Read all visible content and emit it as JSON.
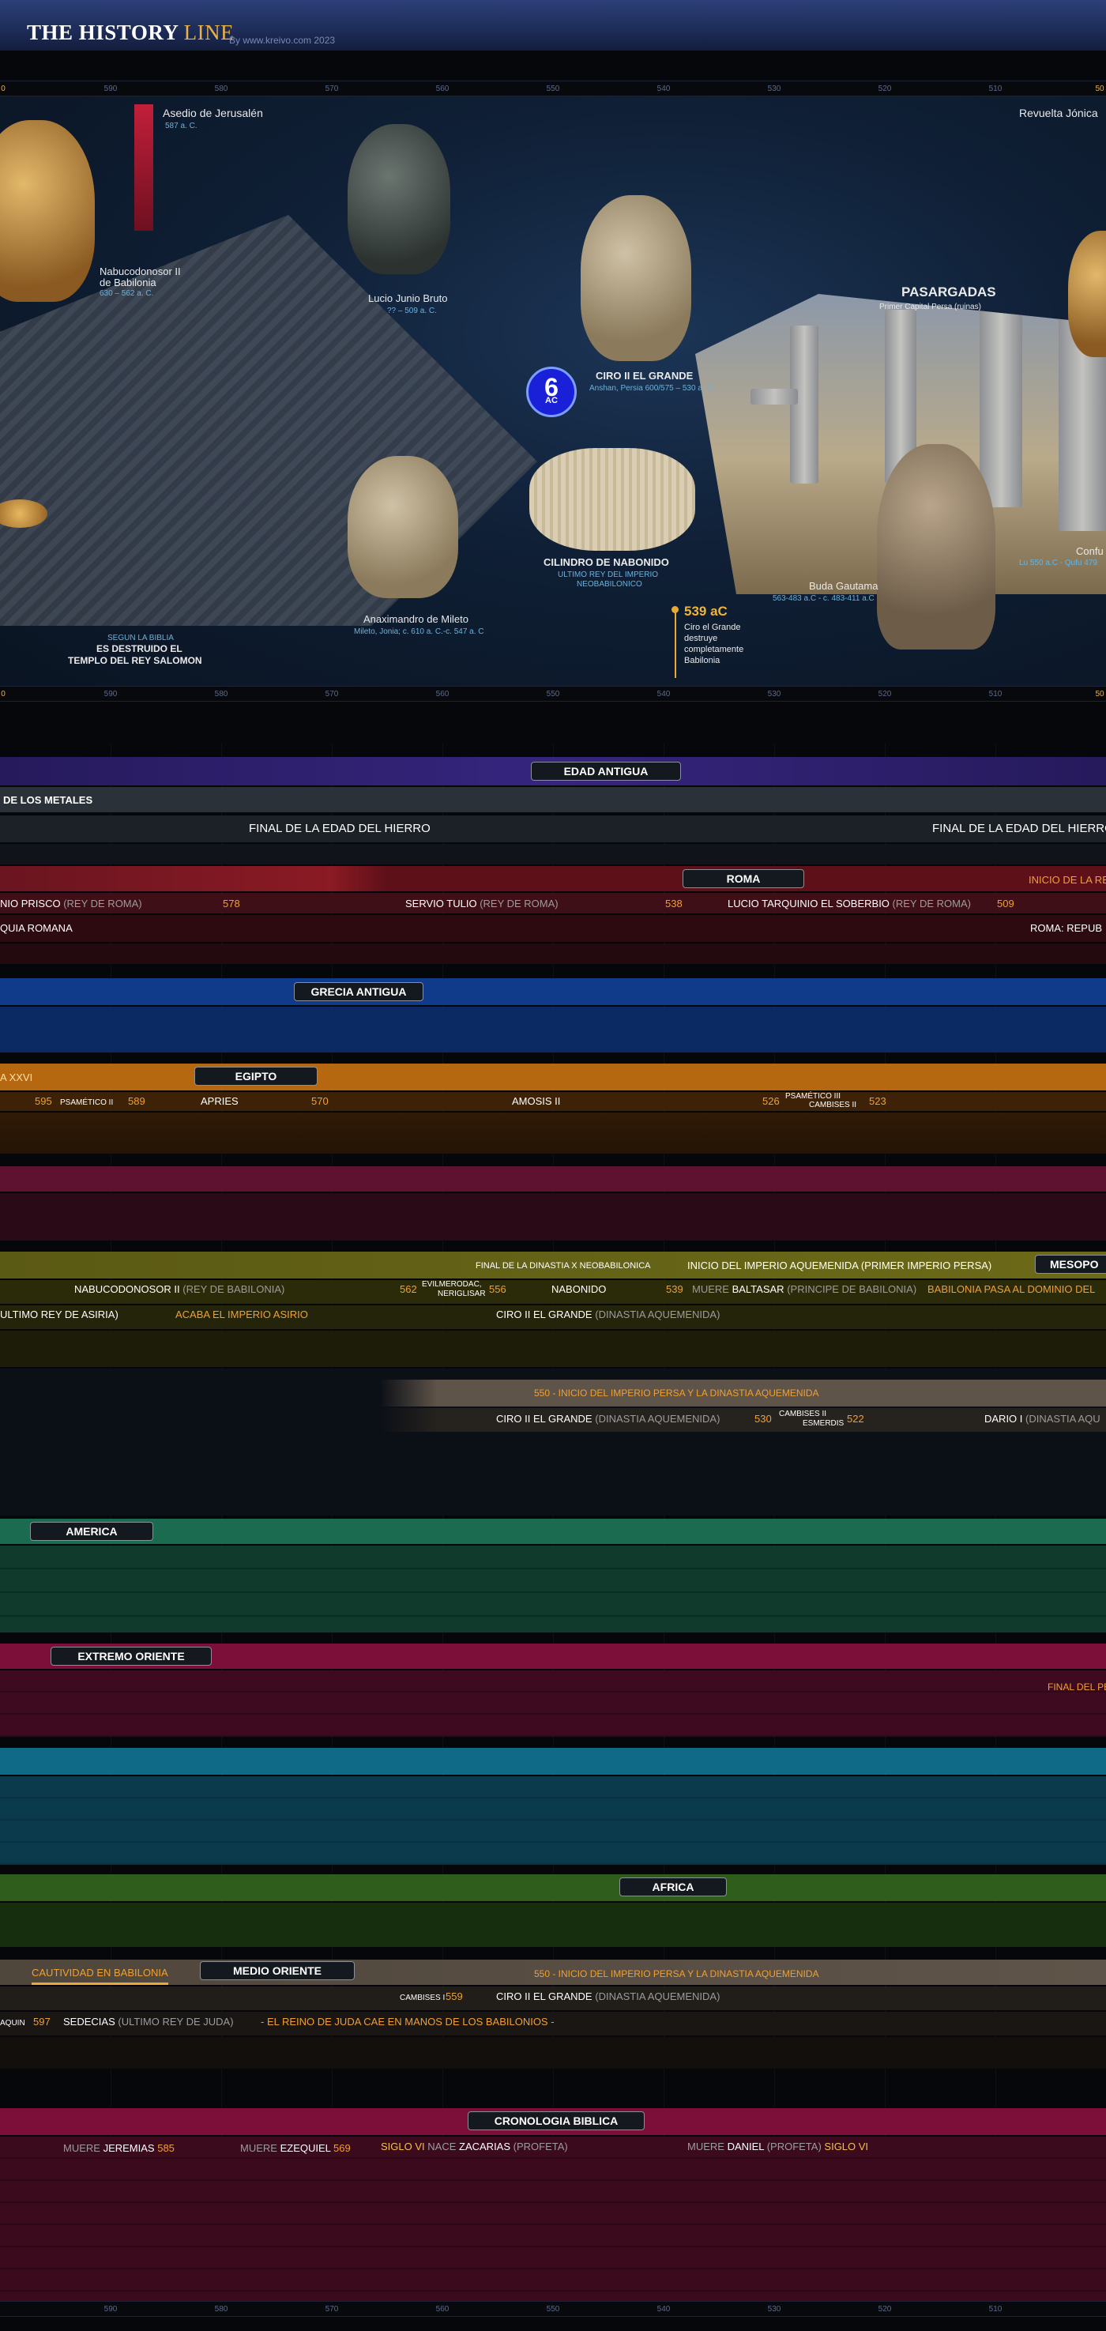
{
  "header": {
    "logo_a": "THE HISTORY",
    "logo_b": "LINE",
    "byline": "By www.kreivo.com 2023"
  },
  "ruler_top": [
    "590",
    "580",
    "570",
    "560",
    "550",
    "540",
    "530",
    "520",
    "510"
  ],
  "ruler_bottom": [
    "590",
    "580",
    "570",
    "560",
    "550",
    "540",
    "530",
    "520",
    "510"
  ],
  "ruler_edge_left": "0",
  "ruler_edge_right": "50",
  "hero": {
    "siege_title": "Asedio de Jerusalén",
    "siege_date": "587 a. C.",
    "revolt": "Revuelta Jónica",
    "nebu_name_1": "Nabucodonosor II",
    "nebu_name_2": "de Babilonia",
    "nebu_dates": "630 – 562 a. C.",
    "bruto_name": "Lucio Junio Bruto",
    "bruto_dates": "?? – 509 a. C.",
    "ciro_name": "CIRO II EL GRANDE",
    "ciro_dates": "Anshan, Persia 600/575 – 530 a. C.",
    "pasargadas": "PASARGADAS",
    "pasargadas_sub": "Primer Capital Persa (ruinas)",
    "century_num": "6",
    "century_sub": "AC",
    "cylinder_name": "CILINDRO DE NABONIDO",
    "cylinder_sub_1": "ULTIMO REY DEL IMPERIO",
    "cylinder_sub_2": "NEOBABILONICO",
    "anax_name": "Anaximandro de Mileto",
    "anax_dates": "Mileto, Jonia; c. 610 a. C.-c. 547 a. C",
    "bible_small": "SEGUN LA BIBLIA",
    "bible_1": "ES DESTRUIDO EL",
    "bible_2": "TEMPLO DEL REY SALOMON",
    "event_year": "539 aC",
    "event_1": "Ciro el Grande",
    "event_2": "destruye",
    "event_3": "completamente",
    "event_4": "Babilonia",
    "buda_name": "Buda Gautama",
    "buda_dates": "563-483 a.C - c. 483-411 a.C",
    "confu_name": "Confu",
    "confu_dates": "Lu 550 a.C - Qufu 479"
  },
  "sections": {
    "edad_antigua": "EDAD ANTIGUA",
    "edad_metales": "DE  LOS METALES",
    "hierro_1": "FINAL DE LA EDAD DEL HIERRO",
    "hierro_2": "FINAL DE LA EDAD DEL HIERRO",
    "roma": "ROMA",
    "roma_right": "INICIO DE LA RE",
    "roma_row": [
      {
        "name": "NIO PRISCO",
        "role": "(REY DE ROMA)",
        "year": "578"
      },
      {
        "name": "SERVIO TULIO",
        "role": "(REY DE ROMA)",
        "year": "538"
      },
      {
        "name": "LUCIO TARQUINIO EL SOBERBIO",
        "role": "(REY DE ROMA)",
        "year": "509"
      }
    ],
    "roma_monarquia": "QUIA ROMANA",
    "roma_repub": "ROMA: REPUB",
    "grecia": "GRECIA ANTIGUA",
    "egipto": "EGIPTO",
    "egipto_dyn": "A XXVI",
    "egipto_row": {
      "y595": "595",
      "psam2": "PSAMÉTICO II",
      "y589": "589",
      "apries": "APRIES",
      "y570": "570",
      "amosis": "AMOSIS II",
      "y526": "526",
      "psam3": "PSAMÉTICO III",
      "camb2": "CAMBISES II",
      "y523": "523"
    },
    "meso_band": "FINAL DE LA DINASTIA X NEOBABILONICA",
    "meso_band_2": "INICIO DEL IMPERIO AQUEMENIDA (PRIMER IMPERIO PERSA)",
    "meso_label": "MESOPO",
    "meso_row": {
      "nebu": "NABUCODONOSOR II",
      "nebu_role": "(REY DE BABILONIA)",
      "y562": "562",
      "evil_1": "EVILMERODAC,",
      "evil_2": "NERIGLISAR",
      "y556": "556",
      "nabonido": "NABONIDO",
      "y539": "539",
      "muere": "MUERE",
      "baltasar": "BALTASAR",
      "baltasar_role": "(PRINCIPE DE BABILONIA)",
      "babilonia": "BABILONIA PASA AL DOMINIO DEL"
    },
    "meso_row2": {
      "asiria": "ULTIMO REY DE ASIRIA)",
      "acaba": "ACABA EL IMPERIO ASIRIO",
      "ciro": "CIRO II EL GRANDE",
      "ciro_role": "(DINASTIA AQUEMENIDA)"
    },
    "persia_band": "550 - INICIO DEL IMPERIO PERSA Y LA DINASTIA AQUEMENIDA",
    "persia_row": {
      "ciro": "CIRO II EL GRANDE",
      "ciro_role": "(DINASTIA AQUEMENIDA)",
      "y530": "530",
      "camb_1": "CAMBISES II",
      "camb_2": "ESMERDIS",
      "y522": "522",
      "dario": "DARIO I",
      "dario_role": "(DINASTIA AQU"
    },
    "america": "AMERICA",
    "extremo": "EXTREMO ORIENTE",
    "extremo_right": "FINAL DEL PE",
    "africa": "AFRICA",
    "medio": "MEDIO ORIENTE",
    "cautividad": "CAUTIVIDAD EN BABILONIA",
    "medio_band": "550 - INICIO DEL IMPERIO PERSA Y LA DINASTIA AQUEMENIDA",
    "medio_row1": {
      "camb": "CAMBISES I",
      "y559": "559",
      "ciro": "CIRO II EL GRANDE",
      "ciro_role": "(DINASTIA AQUEMENIDA)"
    },
    "medio_row2": {
      "aquin": "AQUIN",
      "y597": "597",
      "sedecias": "SEDECIAS",
      "sed_role": "(ULTIMO REY DE JUDA)",
      "juda": "-  EL REINO DE JUDA CAE EN MANOS DE LOS BABILONIOS -"
    },
    "biblica": "CRONOLOGIA BIBLICA",
    "biblica_row": {
      "muere1": "MUERE",
      "jeremias": "JEREMIAS",
      "y585": "585",
      "muere2": "MUERE",
      "ezequiel": "EZEQUIEL",
      "y569": "569",
      "siglo1": "SIGLO VI",
      "nace": "NACE",
      "zacarias": "ZACARIAS",
      "zac_role": "(PROFETA)",
      "muere3": "MUERE",
      "daniel": "DANIEL",
      "dan_role": "(PROFETA)",
      "siglo2": "SIGLO VI"
    }
  },
  "colors": {
    "header": "#1d2c58",
    "edad_antigua": "#2e1f6e",
    "roma": "#8a1a24",
    "grecia": "#0f3b8a",
    "egipto": "#b5680f",
    "meso": "#6c6a18",
    "persia": "#5f5449",
    "america": "#1b6b51",
    "extremo": "#7b0f3a",
    "teal": "#0f6a88",
    "africa": "#2f5e1c",
    "medio": "#5f5449",
    "biblica": "#7b0f3a",
    "century_badge": "#1a1fd8"
  }
}
